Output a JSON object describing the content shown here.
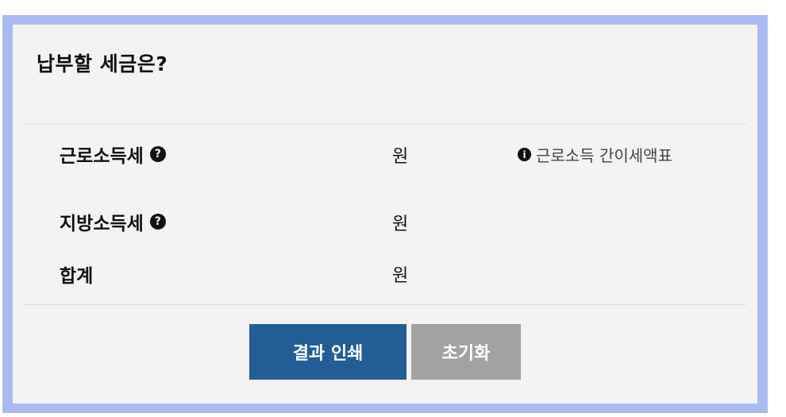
{
  "panel": {
    "title": "납부할 세금은?"
  },
  "rows": [
    {
      "label": "근로소득세",
      "unit": "원",
      "has_help": true
    },
    {
      "label": "지방소득세",
      "unit": "원",
      "has_help": true
    },
    {
      "label": "합계",
      "unit": "원",
      "has_help": false
    }
  ],
  "info_link": {
    "label": "근로소득 간이세액표"
  },
  "buttons": {
    "print_label": "결과 인쇄",
    "reset_label": "초기화"
  },
  "colors": {
    "frame": "#aabbf1",
    "panel_bg": "#f3f3f3",
    "primary_button": "#225e95",
    "secondary_button": "#a2a2a2"
  },
  "icons": {
    "help": "question-circle-icon",
    "info": "info-circle-icon"
  }
}
